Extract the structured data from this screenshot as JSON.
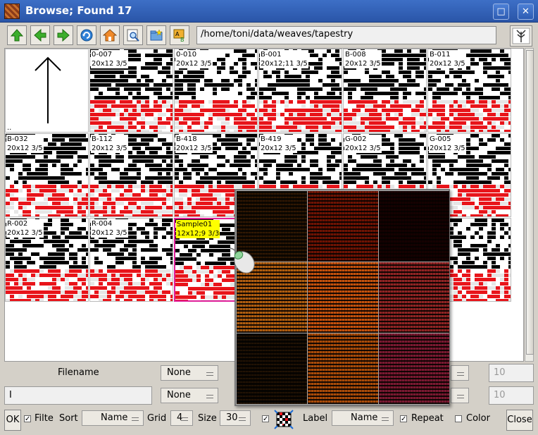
{
  "window": {
    "title": "Browse; Found 17",
    "maximize_glyph": "□",
    "close_glyph": "✕"
  },
  "toolbar": {
    "path": "/home/toni/data/weaves/tapestry",
    "buttons": [
      "arrow-up-icon",
      "arrow-left-icon",
      "arrow-right-icon",
      "refresh-icon",
      "home-icon",
      "zoom-icon",
      "folder-icon",
      "ab-image-icon"
    ]
  },
  "grid": {
    "cells": [
      {
        "name": "..",
        "info": ""
      },
      {
        "name": "0-007",
        "info": "20x12 3/5"
      },
      {
        "name": "0-010",
        "info": "20x12 3/5"
      },
      {
        "name": "B-001",
        "info": "20x12;11 3/5"
      },
      {
        "name": "B-008",
        "info": "20x12 3/5"
      },
      {
        "name": "B-011",
        "info": "20x12 3/5"
      },
      {
        "name": "B-032",
        "info": "20x12 3/5"
      },
      {
        "name": "B-112",
        "info": "20x12 3/5"
      },
      {
        "name": "B-418",
        "info": "20x12 3/5"
      },
      {
        "name": "B-419",
        "info": "20x12 3/5"
      },
      {
        "name": "G-002",
        "info": "20x12 3/5"
      },
      {
        "name": "G-005",
        "info": "20x12 3/5"
      },
      {
        "name": "R-002",
        "info": "20x12 3/5"
      },
      {
        "name": "R-004",
        "info": "20x12 3/5"
      },
      {
        "name": "Sample01",
        "info": "12x12;9 3/3",
        "selected": true
      },
      {
        "name": "",
        "info": ""
      },
      {
        "name": "",
        "info": ""
      },
      {
        "name": "",
        "info": ""
      }
    ],
    "weft_color": "#e8141a",
    "warp_color": "#000000"
  },
  "preview": {
    "colors": [
      [
        "#3a2a10",
        "#a8461a",
        "#4a0c10"
      ],
      [
        "#d49a40",
        "#e0903a",
        "#c06060"
      ],
      [
        "#2a2010",
        "#d08a30",
        "#b05070"
      ]
    ]
  },
  "filter": {
    "filename_label": "Filename",
    "filename_value": "",
    "dropdown1": "None",
    "dropdown2": "None",
    "num1_placeholder": "10",
    "num2_placeholder": "10"
  },
  "bottom": {
    "ok_label": "OK",
    "filter_label": "Filte",
    "filter_checked": "✓",
    "sort_label": "Sort",
    "sort_value": "Name",
    "grid_label": "Grid",
    "grid_value": "4",
    "size_label": "Size",
    "size_value": "30",
    "checkbox_checked": "✓",
    "label_label": "Label",
    "label_value": "Name",
    "repeat_label": "Repeat",
    "repeat_checked": "✓",
    "color_label": "Color",
    "close_label": "Close"
  }
}
